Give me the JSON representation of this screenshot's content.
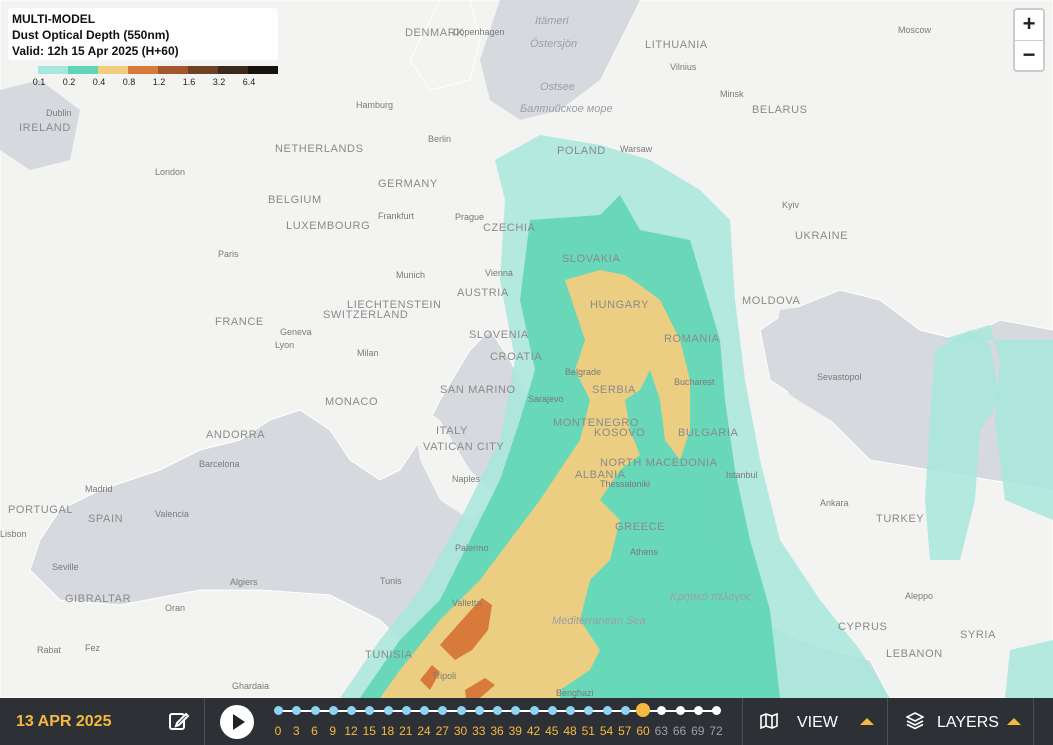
{
  "legend": {
    "line1": "MULTI-MODEL",
    "line2": "Dust Optical Depth (550nm)",
    "line3": "Valid: 12h 15 Apr 2025 (H+60)",
    "scale_colors": [
      "#a7e6dc",
      "#5fd6b4",
      "#f2cd7e",
      "#d77a3a",
      "#a2582b",
      "#6e4225",
      "#3d2a1d",
      "#151210"
    ],
    "scale_labels": [
      "0.1",
      "0.2",
      "0.4",
      "0.8",
      "1.2",
      "1.6",
      "3.2",
      "6.4"
    ]
  },
  "zoom": {
    "in": "+",
    "out": "−"
  },
  "map_labels": {
    "countries": [
      "DENMARK",
      "LITHUANIA",
      "BELARUS",
      "IRELAND",
      "NETHERLANDS",
      "POLAND",
      "GERMANY",
      "BELGIUM",
      "LUXEMBOURG",
      "CZECHIA",
      "UKRAINE",
      "SLOVAKIA",
      "FRANCE",
      "AUSTRIA",
      "LIECHTENSTEIN",
      "SWITZERLAND",
      "HUNGARY",
      "MOLDOVA",
      "ROMANIA",
      "SLOVENIA",
      "CROATIA",
      "SERBIA",
      "MONACO",
      "SAN MARINO",
      "MONTENEGRO",
      "KOSOVO",
      "BULGARIA",
      "ANDORRA",
      "ITALY",
      "VATICAN CITY",
      "NORTH MACEDONIA",
      "ALBANIA",
      "PORTUGAL",
      "SPAIN",
      "GREECE",
      "TURKEY",
      "GIBRALTAR",
      "TUNISIA",
      "CYPRUS",
      "SYRIA",
      "LEBANON"
    ],
    "cities": [
      "Copenhagen",
      "Vilnius",
      "Minsk",
      "Moscow",
      "Dublin",
      "Hamburg",
      "Berlin",
      "Warsaw",
      "London",
      "Frankfurt",
      "Prague",
      "Kyiv",
      "Paris",
      "Munich",
      "Vienna",
      "Geneva",
      "Lyon",
      "Milan",
      "Belgrade",
      "Bucharest",
      "Sevastopol",
      "Sarajevo",
      "Barcelona",
      "Naples",
      "Thessaloniki",
      "Istanbul",
      "Madrid",
      "Valencia",
      "Lisbon",
      "Athens",
      "Ankara",
      "Palermo",
      "Seville",
      "Algiers",
      "Tunis",
      "Oran",
      "Aleppo",
      "Rabat",
      "Fez",
      "Tripoli",
      "Ghardaia",
      "Benghazi",
      "Valletta"
    ],
    "seas": [
      "Östersjön",
      "Itämeri",
      "Ostsee",
      "Балтийское море",
      "Mediterranean Sea",
      "Κρητικό πέλαγος"
    ]
  },
  "bar": {
    "date": "13 APR 2025",
    "hours": [
      "0",
      "3",
      "6",
      "9",
      "12",
      "15",
      "18",
      "21",
      "24",
      "27",
      "30",
      "33",
      "36",
      "39",
      "42",
      "45",
      "48",
      "51",
      "54",
      "57",
      "60",
      "63",
      "66",
      "69",
      "72"
    ],
    "current_hour": "60",
    "current_index": 20,
    "view_label": "VIEW",
    "layers_label": "LAYERS"
  }
}
